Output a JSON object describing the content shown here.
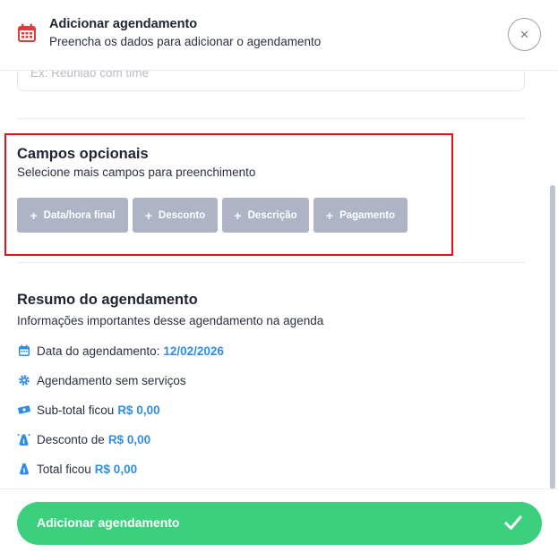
{
  "header": {
    "title": "Adicionar agendamento",
    "subtitle": "Preencha os dados para adicionar o agendamento",
    "close_symbol": "×"
  },
  "previous_field": {
    "placeholder": "Ex: Reunião com time"
  },
  "optional_fields": {
    "title": "Campos opcionais",
    "subtitle": "Selecione mais campos para preenchimento",
    "chips": [
      {
        "label": "Data/hora final"
      },
      {
        "label": "Desconto"
      },
      {
        "label": "Descrição"
      },
      {
        "label": "Pagamento"
      }
    ]
  },
  "summary": {
    "title": "Resumo do agendamento",
    "subtitle": "Informações importantes desse agendamento na agenda",
    "rows": [
      {
        "icon": "calendar-icon",
        "label": "Data do agendamento:",
        "value": "12/02/2026"
      },
      {
        "icon": "gear-icon",
        "label": "Agendamento sem serviços",
        "value": ""
      },
      {
        "icon": "money-icon",
        "label": "Sub-total ficou",
        "value": "R$ 0,00"
      },
      {
        "icon": "discount-bag-icon",
        "label": "Desconto de",
        "value": "R$ 0,00"
      },
      {
        "icon": "money-bag-icon",
        "label": "Total ficou",
        "value": "R$ 0,00"
      }
    ]
  },
  "footer": {
    "submit_label": "Adicionar agendamento"
  },
  "colors": {
    "accent_blue": "#2f8de4",
    "submit_green": "#3ccf7e",
    "chip_gray": "#aeb3c6",
    "highlight_red": "#e0141f",
    "calendar_red": "#e23b3b"
  }
}
